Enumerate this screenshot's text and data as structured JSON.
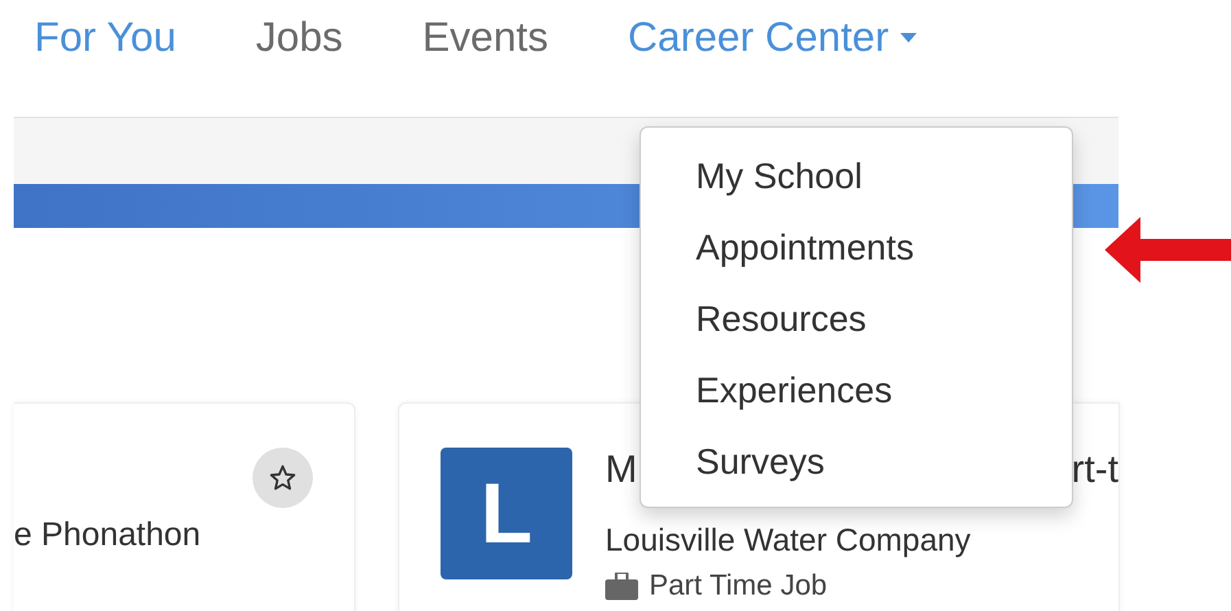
{
  "nav": [
    {
      "label": "For You",
      "highlighted": true,
      "dropdown": false
    },
    {
      "label": "Jobs",
      "highlighted": false,
      "dropdown": false
    },
    {
      "label": "Events",
      "highlighted": false,
      "dropdown": false
    },
    {
      "label": "Career Center",
      "highlighted": true,
      "dropdown": true
    }
  ],
  "menu": {
    "items": [
      "My School",
      "Appointments",
      "Resources",
      "Experiences",
      "Surveys"
    ]
  },
  "cards": [
    {
      "kind": "event",
      "title": "e Phonathon",
      "starred": false
    },
    {
      "kind": "job",
      "logo_letter": "L",
      "title_start": "M",
      "title_end": "rt-t",
      "company": "Louisville Water Company",
      "type": "Part Time Job"
    }
  ]
}
